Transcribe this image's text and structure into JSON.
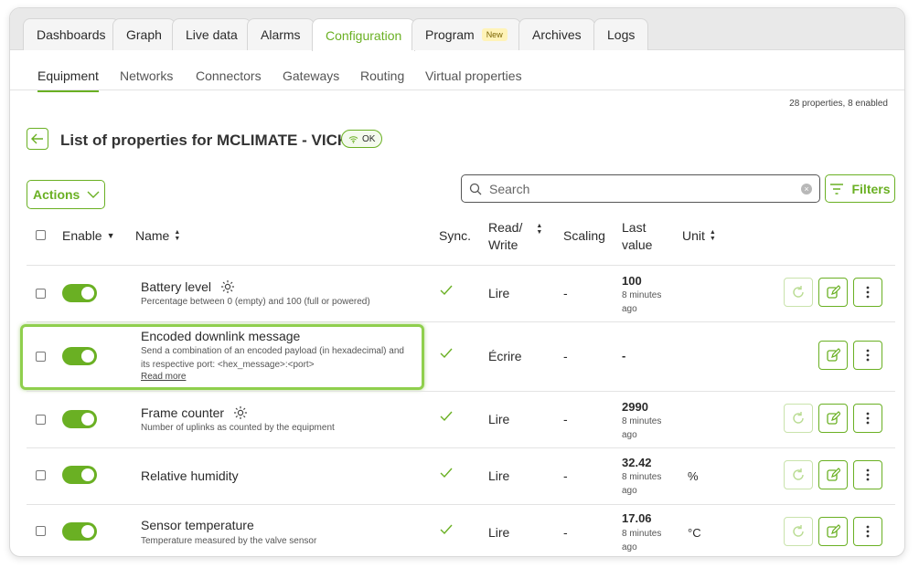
{
  "top_tabs": [
    {
      "label": "Dashboards"
    },
    {
      "label": "Graph"
    },
    {
      "label": "Live data"
    },
    {
      "label": "Alarms"
    },
    {
      "label": "Configuration"
    },
    {
      "label": "Program",
      "badge": "New"
    },
    {
      "label": "Archives"
    },
    {
      "label": "Logs"
    }
  ],
  "sub_tabs": [
    {
      "label": "Equipment"
    },
    {
      "label": "Networks"
    },
    {
      "label": "Connectors"
    },
    {
      "label": "Gateways"
    },
    {
      "label": "Routing"
    },
    {
      "label": "Virtual properties"
    }
  ],
  "properties_count": "28 properties, 8 enabled",
  "page_title": "List of properties for MCLIMATE - VICKI",
  "status_badge": "OK",
  "actions_label": "Actions",
  "search": {
    "placeholder": "Search"
  },
  "filters_label": "Filters",
  "columns": {
    "enable": "Enable",
    "name": "Name",
    "sync": "Sync.",
    "read_write_1": "Read/",
    "read_write_2": "Write",
    "scaling": "Scaling",
    "last_value_1": "Last",
    "last_value_2": "value",
    "unit": "Unit"
  },
  "rows": [
    {
      "name": "Battery level",
      "desc1": "Percentage between 0 (empty) and 100 (full or powered)",
      "desc2": "",
      "read_more": "",
      "mode": "Lire",
      "scaling": "-",
      "value": "100",
      "time1": "8 minutes",
      "time2": "ago",
      "unit": ""
    },
    {
      "name": "Encoded downlink message",
      "desc1": "Send a combination of an encoded payload (in hexadecimal) and",
      "desc2": "its respective port: <hex_message>:<port>",
      "read_more": "Read more",
      "mode": "Écrire",
      "scaling": "-",
      "value": "-",
      "time1": "",
      "time2": "",
      "unit": ""
    },
    {
      "name": "Frame counter",
      "desc1": "Number of uplinks as counted by the equipment",
      "desc2": "",
      "read_more": "",
      "mode": "Lire",
      "scaling": "-",
      "value": "2990",
      "time1": "8 minutes",
      "time2": "ago",
      "unit": ""
    },
    {
      "name": "Relative humidity",
      "desc1": "",
      "desc2": "",
      "read_more": "",
      "mode": "Lire",
      "scaling": "-",
      "value": "32.42",
      "time1": "8 minutes",
      "time2": "ago",
      "unit": "%"
    },
    {
      "name": "Sensor temperature",
      "desc1": "Temperature measured by the valve sensor",
      "desc2": "",
      "read_more": "",
      "mode": "Lire",
      "scaling": "-",
      "value": "17.06",
      "time1": "8 minutes",
      "time2": "ago",
      "unit": "°C"
    }
  ],
  "colors": {
    "accent": "#6ab023",
    "highlight": "#8fcf4d"
  }
}
